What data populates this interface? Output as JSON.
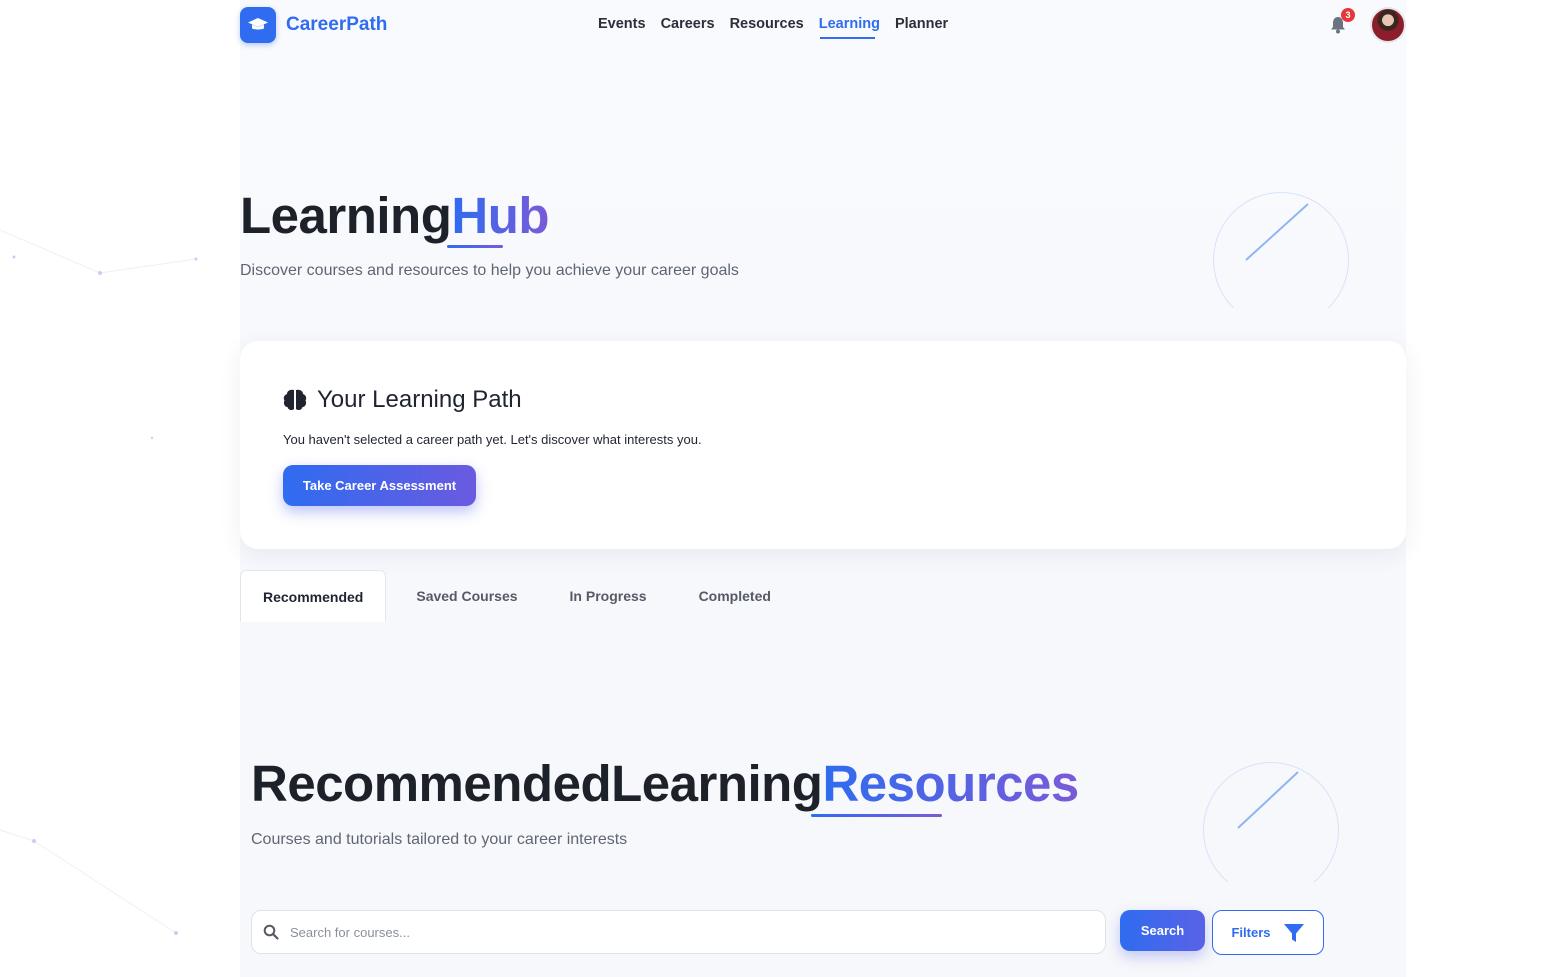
{
  "colors": {
    "accent": "#2f6cf0",
    "accent2": "#7a5ad8",
    "badge": "#e5383b"
  },
  "brand": {
    "name": "CareerPath",
    "icon": "graduation-cap-icon"
  },
  "nav": {
    "items": [
      {
        "label": "Events"
      },
      {
        "label": "Careers"
      },
      {
        "label": "Resources"
      },
      {
        "label": "Learning",
        "active": true
      },
      {
        "label": "Planner"
      }
    ]
  },
  "notifications": {
    "count": "3",
    "icon": "bell-icon"
  },
  "hero": {
    "title_a": "Learning",
    "title_b": "Hub",
    "subtitle": "Discover courses and resources to help you achieve your career goals"
  },
  "path_card": {
    "icon": "brain-icon",
    "title": "Your Learning Path",
    "description": "You haven't selected a career path yet. Let's discover what interests you.",
    "button": "Take Career Assessment"
  },
  "tabs": [
    {
      "label": "Recommended",
      "active": true
    },
    {
      "label": "Saved Courses"
    },
    {
      "label": "In Progress"
    },
    {
      "label": "Completed"
    }
  ],
  "section": {
    "title_a": "Recommended",
    "title_b": "Learning",
    "title_c": "Resources",
    "subtitle": "Courses and tutorials tailored to your career interests"
  },
  "search": {
    "placeholder": "Search for courses...",
    "value": "",
    "button": "Search",
    "filters_label": "Filters",
    "filter_icon": "funnel-icon"
  }
}
